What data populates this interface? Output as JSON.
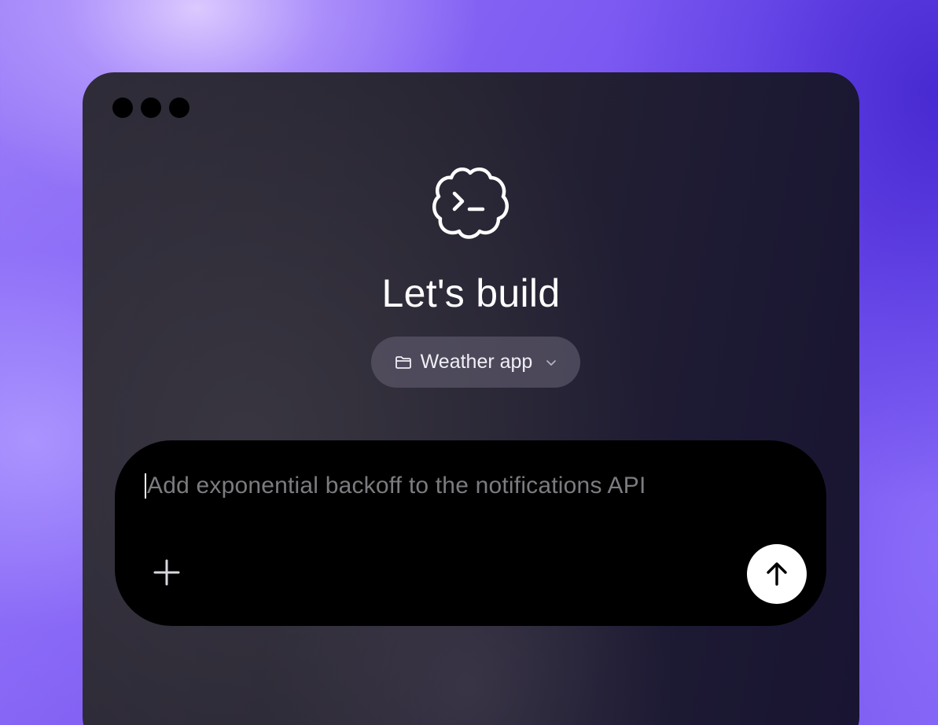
{
  "window": {
    "traffic_lights": [
      "close",
      "minimize",
      "zoom"
    ]
  },
  "hero": {
    "logo_icon": "cloud-terminal-icon",
    "title": "Let's build"
  },
  "project_selector": {
    "icon": "folder-icon",
    "label": "Weather app",
    "dropdown_icon": "chevron-down-icon"
  },
  "composer": {
    "placeholder": "Add exponential backoff to the notifications API",
    "value": "",
    "add_icon": "plus-icon",
    "send_icon": "arrow-up-icon"
  },
  "colors": {
    "window_bg": "#27243a",
    "composer_bg": "#000000",
    "pill_bg": "#5a5668",
    "send_button_bg": "#ffffff",
    "placeholder_text": "#7c7b80"
  }
}
